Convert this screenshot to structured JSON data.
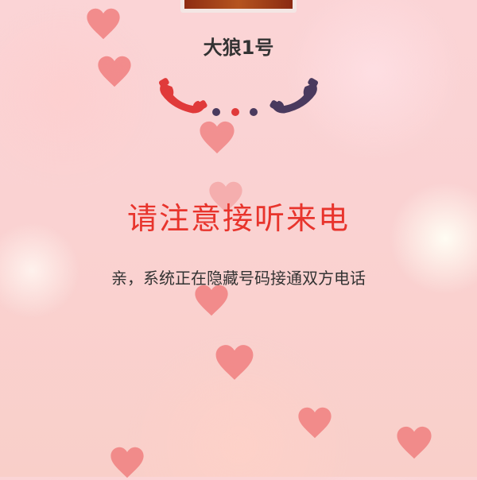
{
  "caller": {
    "name": "大狼1号"
  },
  "call_status": {
    "title": "请注意接听来电",
    "message": "亲，系统正在隐藏号码接通双方电话"
  },
  "icons": {
    "caller_phone": "phone-handset-icon",
    "callee_phone": "phone-handset-icon",
    "connecting_dots": "ellipsis-icon",
    "decor": "heart-icon"
  },
  "colors": {
    "accent_red": "#e8342c",
    "phone_left": "#e03a3a",
    "phone_right": "#4a3a5e",
    "heart": "#f07f7f"
  }
}
